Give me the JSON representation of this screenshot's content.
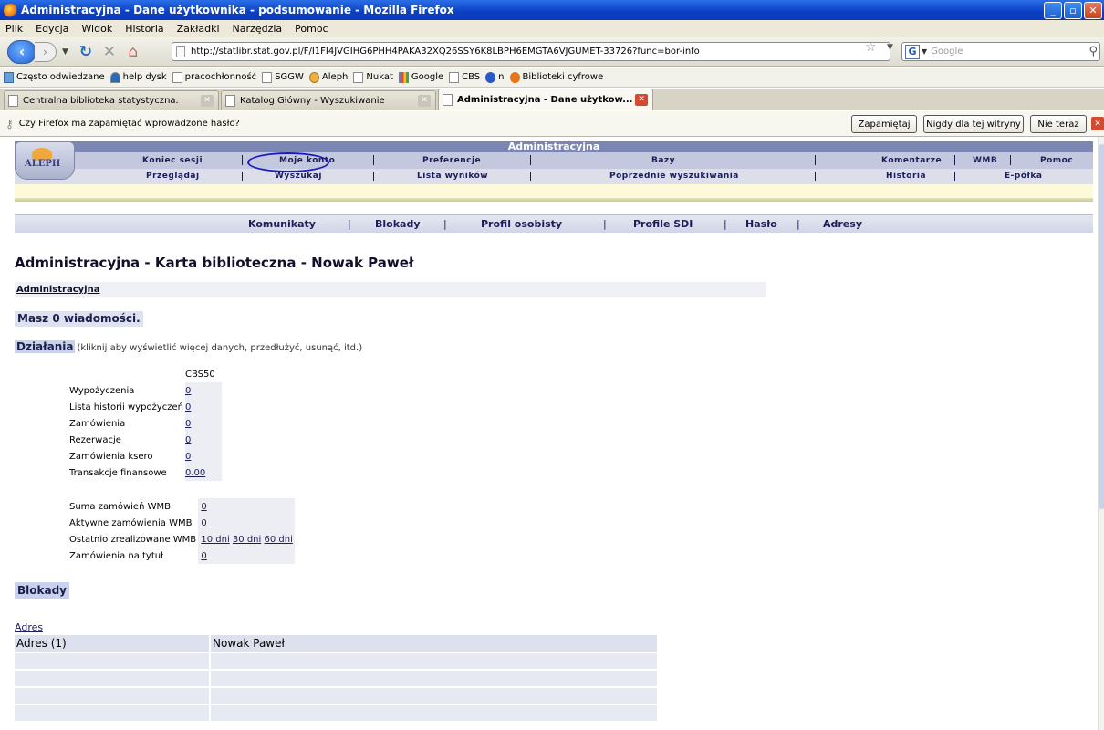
{
  "window": {
    "title": "Administracyjna - Dane użytkownika - podsumowanie - Mozilla Firefox",
    "controls": [
      "_",
      "▫",
      "✕"
    ]
  },
  "menu": [
    "Plik",
    "Edycja",
    "Widok",
    "Historia",
    "Zakładki",
    "Narzędzia",
    "Pomoc"
  ],
  "nav": {
    "url": "http://statlibr.stat.gov.pl/F/I1FI4JVGIHG6PHH4PAKA32XQ26SSY6K8LBPH6EMGTA6VJGUMET-33726?func=bor-info",
    "search_placeholder": "Google",
    "search_engine": "G"
  },
  "bookmarks": [
    "Często odwiedzane",
    "help dysk",
    "pracochłonność",
    "SGGW",
    "Aleph",
    "Nukat",
    "Google",
    "CBS",
    "n",
    "Biblioteki cyfrowe"
  ],
  "tabs": [
    {
      "label": "Centralna biblioteka statystyczna."
    },
    {
      "label": "Katalog Główny - Wyszukiwanie"
    },
    {
      "label": "Administracyjna - Dane użytkow..."
    }
  ],
  "password_bar": {
    "text": "Czy Firefox ma zapamiętać wprowadzone hasło?",
    "remember": "Zapamiętaj",
    "never": "Nigdy dla tej witryny",
    "not_now": "Nie teraz"
  },
  "aleph": {
    "logo_text": "ALEPH",
    "base_name": "Administracyjna",
    "row1": [
      "Koniec sesji",
      "Moje konto",
      "Preferencje",
      "Bazy",
      "Komentarze",
      "WMB",
      "Pomoc"
    ],
    "row2": [
      "Przeglądaj",
      "Wyszukaj",
      "Lista wyników",
      "Poprzednie wyszukiwania",
      "Historia",
      "E-półka"
    ],
    "subnav": [
      "Komunikaty",
      "Blokady",
      "Profil osobisty",
      "Profile SDI",
      "Hasło",
      "Adresy"
    ]
  },
  "page": {
    "title": "Administracyjna - Karta biblioteczna - Nowak Paweł",
    "breadcrumb": "Administracyjna",
    "messages": "Masz 0 wiadomości.",
    "actions_heading": "Działania",
    "actions_note": "(kliknij aby wyświetlić więcej danych, przedłużyć, usunąć, itd.)",
    "column": "CBS50",
    "rows": [
      {
        "label": "Wypożyczenia",
        "value": "0"
      },
      {
        "label": "Lista historii wypożyczeń",
        "value": "0"
      },
      {
        "label": "Zamówienia",
        "value": "0"
      },
      {
        "label": "Rezerwacje",
        "value": "0"
      },
      {
        "label": "Zamówienia ksero",
        "value": "0"
      },
      {
        "label": "Transakcje finansowe",
        "value": "0.00"
      }
    ],
    "wmb": {
      "suma_label": "Suma zamówień WMB",
      "suma_value": "0",
      "aktywne_label": "Aktywne zamówienia WMB",
      "aktywne_value": "0",
      "ostatnio_label": "Ostatnio zrealizowane WMB",
      "ostatnio_links": [
        "10 dni",
        "30 dni",
        "60 dni"
      ],
      "tytul_label": "Zamówienia na tytuł",
      "tytul_value": "0"
    },
    "blokady": "Blokady",
    "adres_link": "Adres",
    "address_header": {
      "c1": "Adres (1)",
      "c2": "Nowak Paweł"
    }
  }
}
